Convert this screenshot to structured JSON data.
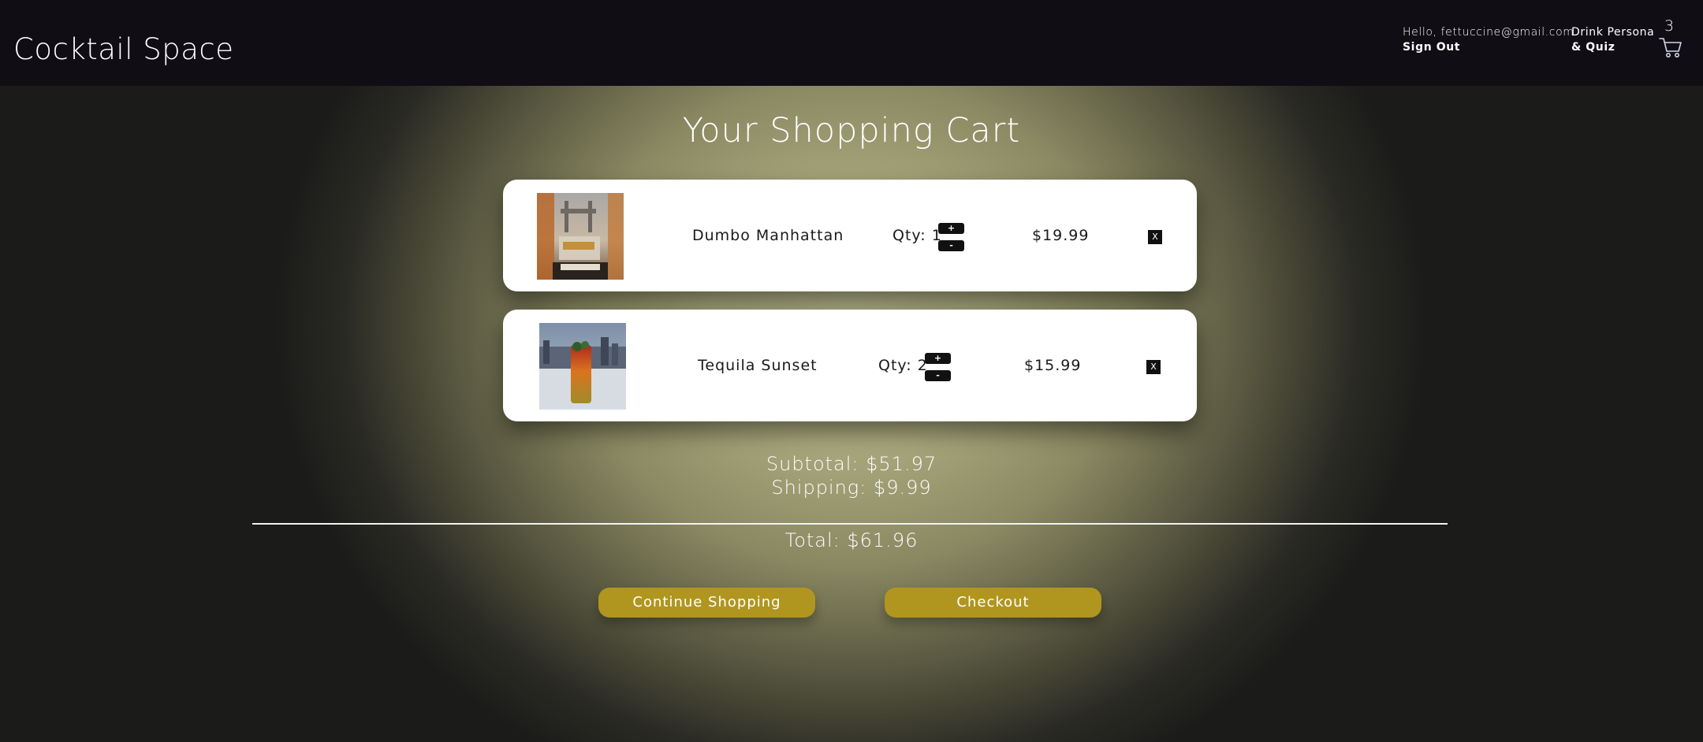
{
  "header": {
    "brand": "Cocktail Space",
    "greeting": "Hello, fettuccine@gmail.com",
    "sign_out": "Sign Out",
    "persona_line1": "Drink Persona",
    "persona_line2": "& Quiz",
    "cart_count": "3"
  },
  "cart": {
    "title": "Your Shopping Cart",
    "items": [
      {
        "name": "Dumbo Manhattan",
        "qty_label": "Qty: 1",
        "qty": 1,
        "plus": "+",
        "minus": "-",
        "price": "$19.99",
        "remove": "X",
        "image": "dumbo-manhattan-photo"
      },
      {
        "name": "Tequila Sunset",
        "qty_label": "Qty: 2",
        "qty": 2,
        "plus": "+",
        "minus": "-",
        "price": "$15.99",
        "remove": "X",
        "image": "tequila-sunset-photo"
      }
    ],
    "subtotal": "Subtotal: $51.97",
    "shipping": "Shipping: $9.99",
    "total": "Total: $61.96",
    "continue_label": "Continue Shopping",
    "checkout_label": "Checkout"
  },
  "colors": {
    "header_bg": "#110d15",
    "accent_button": "#b0961f",
    "card_bg": "#ffffff"
  },
  "icons": {
    "cart": "shopping-cart-icon"
  }
}
